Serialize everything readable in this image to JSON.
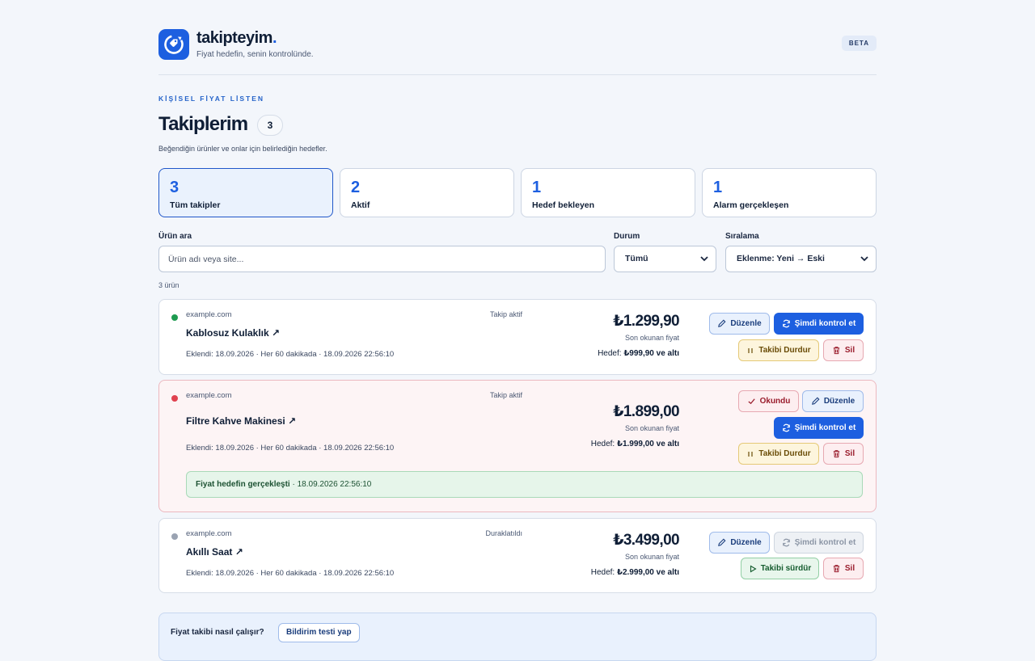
{
  "brand": {
    "name": "takipteyim",
    "dot": ".",
    "tagline": "Fiyat hedefin, senin kontrolünde.",
    "beta": "BETA"
  },
  "page": {
    "eyebrow": "KİŞİSEL FİYAT LİSTEN",
    "title": "Takiplerim",
    "count": "3",
    "subtitle": "Beğendiğin ürünler ve onlar için belirlediğin hedefler."
  },
  "stats": [
    {
      "num": "3",
      "label": "Tüm takipler"
    },
    {
      "num": "2",
      "label": "Aktif"
    },
    {
      "num": "1",
      "label": "Hedef bekleyen"
    },
    {
      "num": "1",
      "label": "Alarm gerçekleşen"
    }
  ],
  "filters": {
    "search_label": "Ürün ara",
    "search_placeholder": "Ürün adı veya site...",
    "status_label": "Durum",
    "status_value": "Tümü",
    "sort_label": "Sıralama",
    "sort_value": "Eklenme: Yeni → Eski",
    "item_count": "3 ürün"
  },
  "items": [
    {
      "site": "example.com",
      "name": "Kablosuz Kulaklık",
      "status": "Takip aktif",
      "meta": "Eklendi: 18.09.2026 · Her 60 dakikada · 18.09.2026 22:56:10",
      "price": "₺1.299,90",
      "price_label": "Son okunan fiyat",
      "target_prefix": "Hedef:",
      "target": "₺999,90 ve altı",
      "dot_color": "#1e9b50"
    },
    {
      "site": "example.com",
      "name": "Filtre Kahve Makinesi",
      "status": "Takip aktif",
      "meta": "Eklendi: 18.09.2026 · Her 60 dakikada · 18.09.2026 22:56:10",
      "price": "₺1.899,00",
      "price_label": "Son okunan fiyat",
      "target_prefix": "Hedef:",
      "target": "₺1.999,00 ve altı",
      "dot_color": "#e0414f",
      "alert_title": "Fiyat hedefin gerçekleşti",
      "alert_time": "· 18.09.2026 22:56:10"
    },
    {
      "site": "example.com",
      "name": "Akıllı Saat",
      "status": "Duraklatıldı",
      "meta": "Eklendi: 18.09.2026 · Her 60 dakikada · 18.09.2026 22:56:10",
      "price": "₺3.499,00",
      "price_label": "Son okunan fiyat",
      "target_prefix": "Hedef:",
      "target": "₺2.999,00 ve altı",
      "dot_color": "#9aa3b2"
    }
  ],
  "actions": {
    "edit": "Düzenle",
    "check_now": "Şimdi kontrol et",
    "pause": "Takibi Durdur",
    "delete": "Sil",
    "mark_read": "Okundu",
    "resume": "Takibi sürdür"
  },
  "help": {
    "question": "Fiyat takibi nasıl çalışır?",
    "test_button": "Bildirim testi yap"
  },
  "colors": {
    "accent": "#1d5fe0",
    "page_bg": "#f3f6fb"
  }
}
